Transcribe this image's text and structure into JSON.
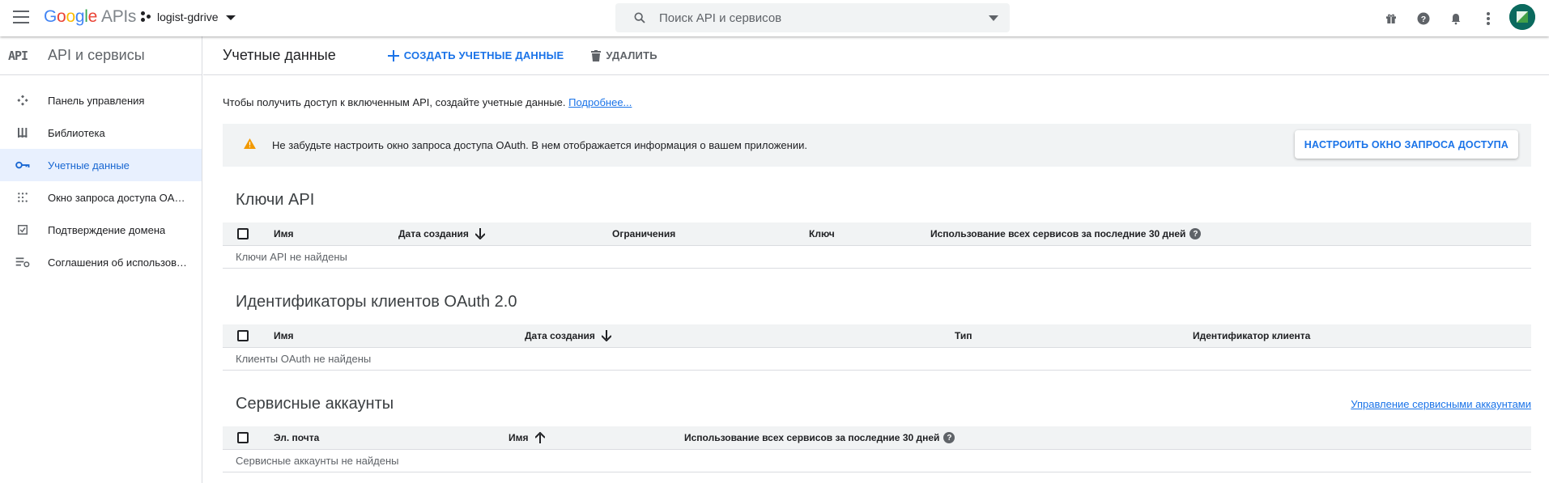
{
  "topbar": {
    "logo_letters": [
      "G",
      "o",
      "o",
      "g",
      "l",
      "e"
    ],
    "logo_suffix": "APIs",
    "project_name": "logist-gdrive",
    "search_placeholder": "Поиск API и сервисов",
    "icons": [
      "gift-icon",
      "help-icon",
      "notifications-icon",
      "more-vert-icon"
    ]
  },
  "sidebar": {
    "api_badge": "API",
    "title": "API и сервисы",
    "items": [
      {
        "label": "Панель управления",
        "icon": "dashboard-icon",
        "active": false
      },
      {
        "label": "Библиотека",
        "icon": "library-icon",
        "active": false
      },
      {
        "label": "Учетные данные",
        "icon": "key-icon",
        "active": true
      },
      {
        "label": "Окно запроса доступа OAuth",
        "icon": "consent-icon",
        "active": false
      },
      {
        "label": "Подтверждение домена",
        "icon": "domain-check-icon",
        "active": false
      },
      {
        "label": "Соглашения об использовании",
        "icon": "agreements-icon",
        "active": false
      }
    ]
  },
  "header": {
    "title": "Учетные данные",
    "create_label": "СОЗДАТЬ УЧЕТНЫЕ ДАННЫЕ",
    "delete_label": "УДАЛИТЬ"
  },
  "intro": {
    "text": "Чтобы получить доступ к включенным API, создайте учетные данные.",
    "link": "Подробнее..."
  },
  "warning": {
    "text": "Не забудьте настроить окно запроса доступа OAuth. В нем отображается информация о вашем приложении.",
    "button": "НАСТРОИТЬ ОКНО ЗАПРОСА ДОСТУПА"
  },
  "api_keys": {
    "title": "Ключи API",
    "columns": [
      "Имя",
      "Дата создания",
      "Ограничения",
      "Ключ",
      "Использование всех сервисов за последние 30 дней"
    ],
    "empty": "Ключи API не найдены"
  },
  "oauth": {
    "title": "Идентификаторы клиентов OAuth 2.0",
    "columns": [
      "Имя",
      "Дата создания",
      "Тип",
      "Идентификатор клиента"
    ],
    "empty": "Клиенты OAuth не найдены"
  },
  "service_accounts": {
    "title": "Сервисные аккаунты",
    "manage_link": "Управление сервисными аккаунтами",
    "columns": [
      "Эл. почта",
      "Имя",
      "Использование всех сервисов за последние 30 дней"
    ],
    "empty": "Сервисные аккаунты не найдены"
  },
  "colors": {
    "accent": "#1a73e8",
    "active_bg": "#e8f0fe",
    "warning": "#f29900",
    "header_bg": "#f1f3f4"
  }
}
